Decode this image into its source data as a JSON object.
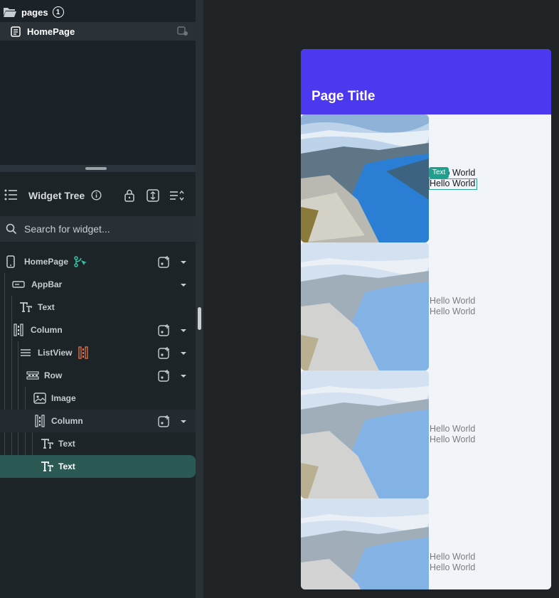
{
  "pages_panel": {
    "title": "pages",
    "count": "1",
    "page_item": "HomePage"
  },
  "widget_tree": {
    "title": "Widget Tree",
    "search_placeholder": "Search for widget...",
    "nodes": {
      "homepage": "HomePage",
      "appbar": "AppBar",
      "text_appbar": "Text",
      "column_root": "Column",
      "listview": "ListView",
      "row": "Row",
      "image": "Image",
      "column_inner": "Column",
      "text_1": "Text",
      "text_2": "Text"
    }
  },
  "preview": {
    "appbar_title": "Page Title",
    "selected_chip": "Text",
    "rows": [
      {
        "line1": "Hello World",
        "line2": "Hello World"
      },
      {
        "line1": "Hello World",
        "line2": "Hello World"
      },
      {
        "line1": "Hello World",
        "line2": "Hello World"
      },
      {
        "line1": "Hello World",
        "line2": "Hello World"
      }
    ]
  },
  "colors": {
    "appbar": "#4b39ef",
    "selection": "#2b5a55",
    "accent": "#20a08c"
  }
}
